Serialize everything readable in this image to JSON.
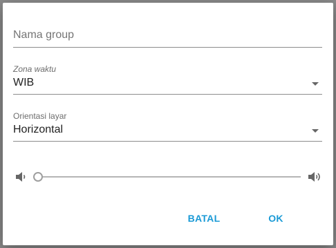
{
  "dialog": {
    "group_name": {
      "placeholder": "Nama group",
      "value": ""
    },
    "timezone": {
      "label": "Zona waktu",
      "value": "WIB"
    },
    "orientation": {
      "label": "Orientasi layar",
      "value": "Horizontal"
    },
    "volume": {
      "level": 0,
      "low_icon": "volume-down-icon",
      "high_icon": "volume-up-icon"
    },
    "buttons": {
      "cancel_label": "BATAL",
      "ok_label": "OK"
    }
  },
  "colors": {
    "accent": "#1a9ad6",
    "backdrop": "#8a8a8a",
    "underline": "#8c8c8c"
  }
}
